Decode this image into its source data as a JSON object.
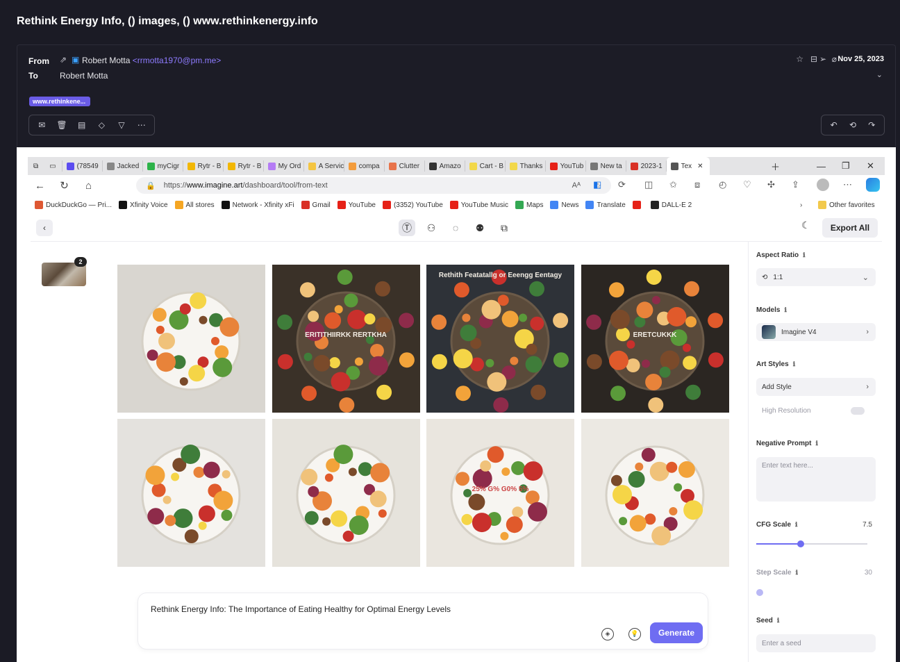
{
  "mail": {
    "subject": "Rethink Energy Info, () images, () www.rethinkenergy.info",
    "from_label": "From",
    "to_label": "To",
    "from_name": "Robert Motta",
    "from_email": "<rrmotta1970@pm.me>",
    "to_name": "Robert Motta",
    "date": "Nov 25, 2023",
    "attachment_pill": "www.rethinkene..."
  },
  "browser": {
    "tabs": [
      {
        "label": "(78549",
        "color": "#5b4cf0"
      },
      {
        "label": "Jacked",
        "color": "#888888"
      },
      {
        "label": "myCigr",
        "color": "#2db34a"
      },
      {
        "label": "Rytr - B",
        "color": "#f2b705"
      },
      {
        "label": "Rytr - B",
        "color": "#f2b705"
      },
      {
        "label": "My Ord",
        "color": "#b57cf5"
      },
      {
        "label": "A Servic",
        "color": "#f4c542"
      },
      {
        "label": "compa",
        "color": "#f39c3c"
      },
      {
        "label": "Clutter",
        "color": "#e8734a"
      },
      {
        "label": "Amazo",
        "color": "#333333"
      },
      {
        "label": "Cart - B",
        "color": "#f2d84a"
      },
      {
        "label": "Thanks",
        "color": "#f2d84a"
      },
      {
        "label": "YouTub",
        "color": "#e62117"
      },
      {
        "label": "New ta",
        "color": "#777777"
      },
      {
        "label": "2023-1",
        "color": "#d93025"
      },
      {
        "label": "Tex",
        "color": "#555555"
      }
    ],
    "url_prefix": "https://",
    "url_domain": "www.imagine.art",
    "url_path": "/dashboard/tool/from-text",
    "bookmarks": [
      {
        "label": "DuckDuckGo — Pri...",
        "color": "#de5833"
      },
      {
        "label": "Xfinity Voice",
        "color": "#111111"
      },
      {
        "label": "All stores",
        "color": "#f5a623"
      },
      {
        "label": "Network - Xfinity xFi",
        "color": "#111111"
      },
      {
        "label": "Gmail",
        "color": "#d93025"
      },
      {
        "label": "YouTube",
        "color": "#e62117"
      },
      {
        "label": "(3352) YouTube",
        "color": "#e62117"
      },
      {
        "label": "YouTube Music",
        "color": "#e62117"
      },
      {
        "label": "Maps",
        "color": "#34a853"
      },
      {
        "label": "News",
        "color": "#4285f4"
      },
      {
        "label": "Translate",
        "color": "#4285f4"
      },
      {
        "label": "",
        "color": "#e62117"
      },
      {
        "label": "DALL-E 2",
        "color": "#222222"
      }
    ],
    "other_favorites": "Other favorites"
  },
  "app": {
    "export_label": "Export All",
    "thumb_count": "2",
    "prompt": "Rethink Energy Info: The Importance of Eating Healthy for Optimal Energy Levels",
    "generate_label": "Generate",
    "images": [
      {
        "caption": "",
        "bg": "#d9d6d0"
      },
      {
        "caption": "ERITITHIIRKK RERTKHA",
        "bg": "#3a3128"
      },
      {
        "caption": "Rethith Featatallg or Eeengg Eentagy",
        "bg": "#2e3238"
      },
      {
        "caption": "ERETCUKKK",
        "bg": "#2b2622"
      },
      {
        "caption": "",
        "bg": "#e4e2de"
      },
      {
        "caption": "",
        "bg": "#e6e3dc"
      },
      {
        "caption": "25% G% G0% 5%",
        "bg": "#eae6df"
      },
      {
        "caption": "",
        "bg": "#ece9e3"
      }
    ]
  },
  "settings": {
    "aspect_label": "Aspect Ratio",
    "aspect_value": "1:1",
    "models_label": "Models",
    "model_value": "Imagine V4",
    "art_styles_label": "Art Styles",
    "add_style": "Add Style",
    "high_res": "High Resolution",
    "negative_label": "Negative Prompt",
    "negative_placeholder": "Enter text here...",
    "cfg_label": "CFG Scale",
    "cfg_value": "7.5",
    "cfg_fraction": 0.4,
    "step_label": "Step Scale",
    "step_value": "30",
    "step_fraction": 0.0,
    "seed_label": "Seed",
    "seed_placeholder": "Enter a seed"
  }
}
